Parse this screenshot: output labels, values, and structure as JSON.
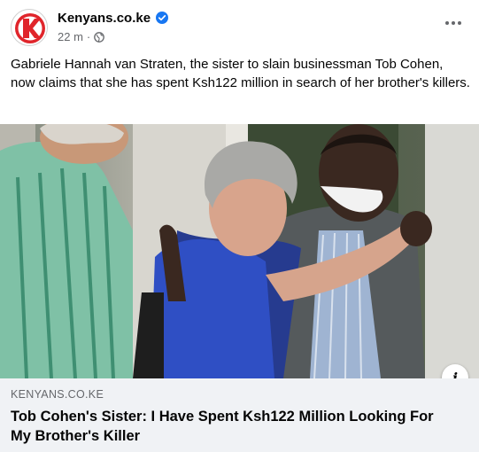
{
  "post": {
    "page_name": "Kenyans.co.ke",
    "time": "22 m",
    "separator": "·",
    "text": "Gabriele Hannah van Straten, the sister to slain businessman Tob Cohen, now claims that she has spent Ksh122 million in search of her brother's killers."
  },
  "icons": {
    "verified": "verified-badge-icon",
    "privacy": "globe-icon",
    "more": "more-options-icon",
    "info": "info-icon"
  },
  "link": {
    "domain": "KENYANS.CO.KE",
    "title": "Tob Cohen's Sister: I Have Spent Ksh122 Million Looking For My Brother's Killer",
    "info_glyph": "i"
  },
  "colors": {
    "verified": "#1877f2",
    "logo_red": "#e0252b",
    "secondary_text": "#65676b",
    "link_bg": "#f0f2f5"
  }
}
